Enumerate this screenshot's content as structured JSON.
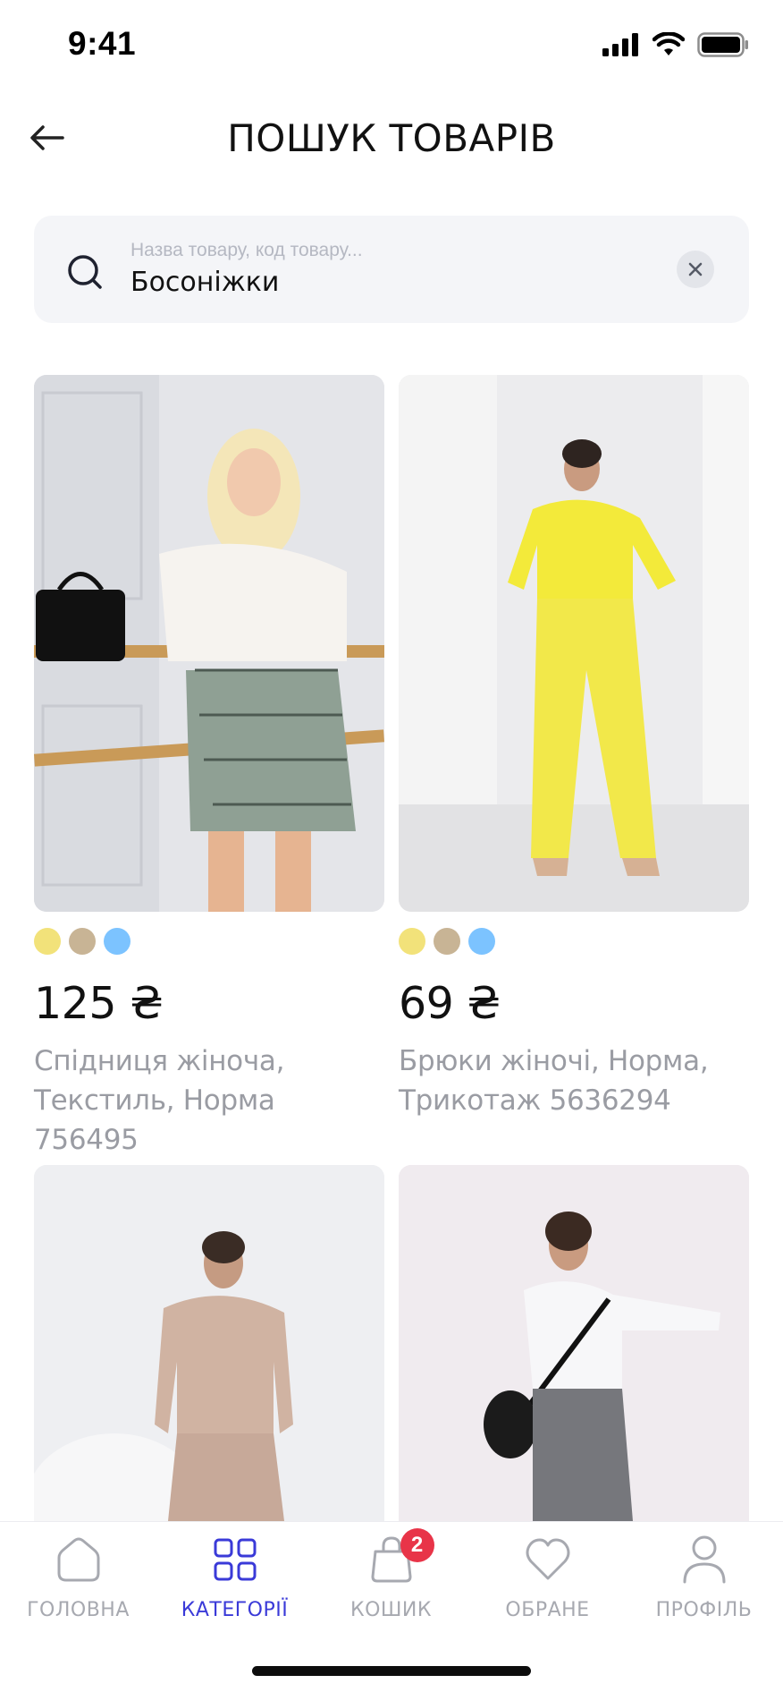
{
  "status_bar": {
    "time": "9:41"
  },
  "header": {
    "title": "ПОШУК ТОВАРІВ"
  },
  "search": {
    "placeholder": "Назва товару, код товару...",
    "value": "Босоніжки"
  },
  "products": [
    {
      "price": "125 ₴",
      "description": "Спідниця жіноча, Текстиль, Норма 756495",
      "swatches": [
        "#f2e27a",
        "#c8b495",
        "#7cc3ff"
      ],
      "image_subject": "woman-in-white-top-and-checked-skirt"
    },
    {
      "price": "69 ₴",
      "description": "Брюки жіночі, Норма, Трикотаж 5636294",
      "swatches": [
        "#f2e27a",
        "#c8b495",
        "#7cc3ff"
      ],
      "image_subject": "woman-in-yellow-tracksuit"
    },
    {
      "image_subject": "woman-in-beige-tracksuit"
    },
    {
      "image_subject": "woman-in-white-shirt-and-grey-trousers"
    }
  ],
  "tab_bar": {
    "tabs": [
      {
        "label": "ГОЛОВНА",
        "icon": "home-icon",
        "active": false
      },
      {
        "label": "КАТЕГОРІЇ",
        "icon": "grid-icon",
        "active": true
      },
      {
        "label": "КОШИК",
        "icon": "bag-icon",
        "active": false,
        "badge": "2"
      },
      {
        "label": "ОБРАНЕ",
        "icon": "heart-icon",
        "active": false
      },
      {
        "label": "ПРОФІЛЬ",
        "icon": "user-icon",
        "active": false
      }
    ]
  },
  "colors": {
    "accent": "#3a3ad8",
    "badge": "#e83448",
    "inactive": "#a7a9b0",
    "search_bg": "#f4f5f8"
  }
}
